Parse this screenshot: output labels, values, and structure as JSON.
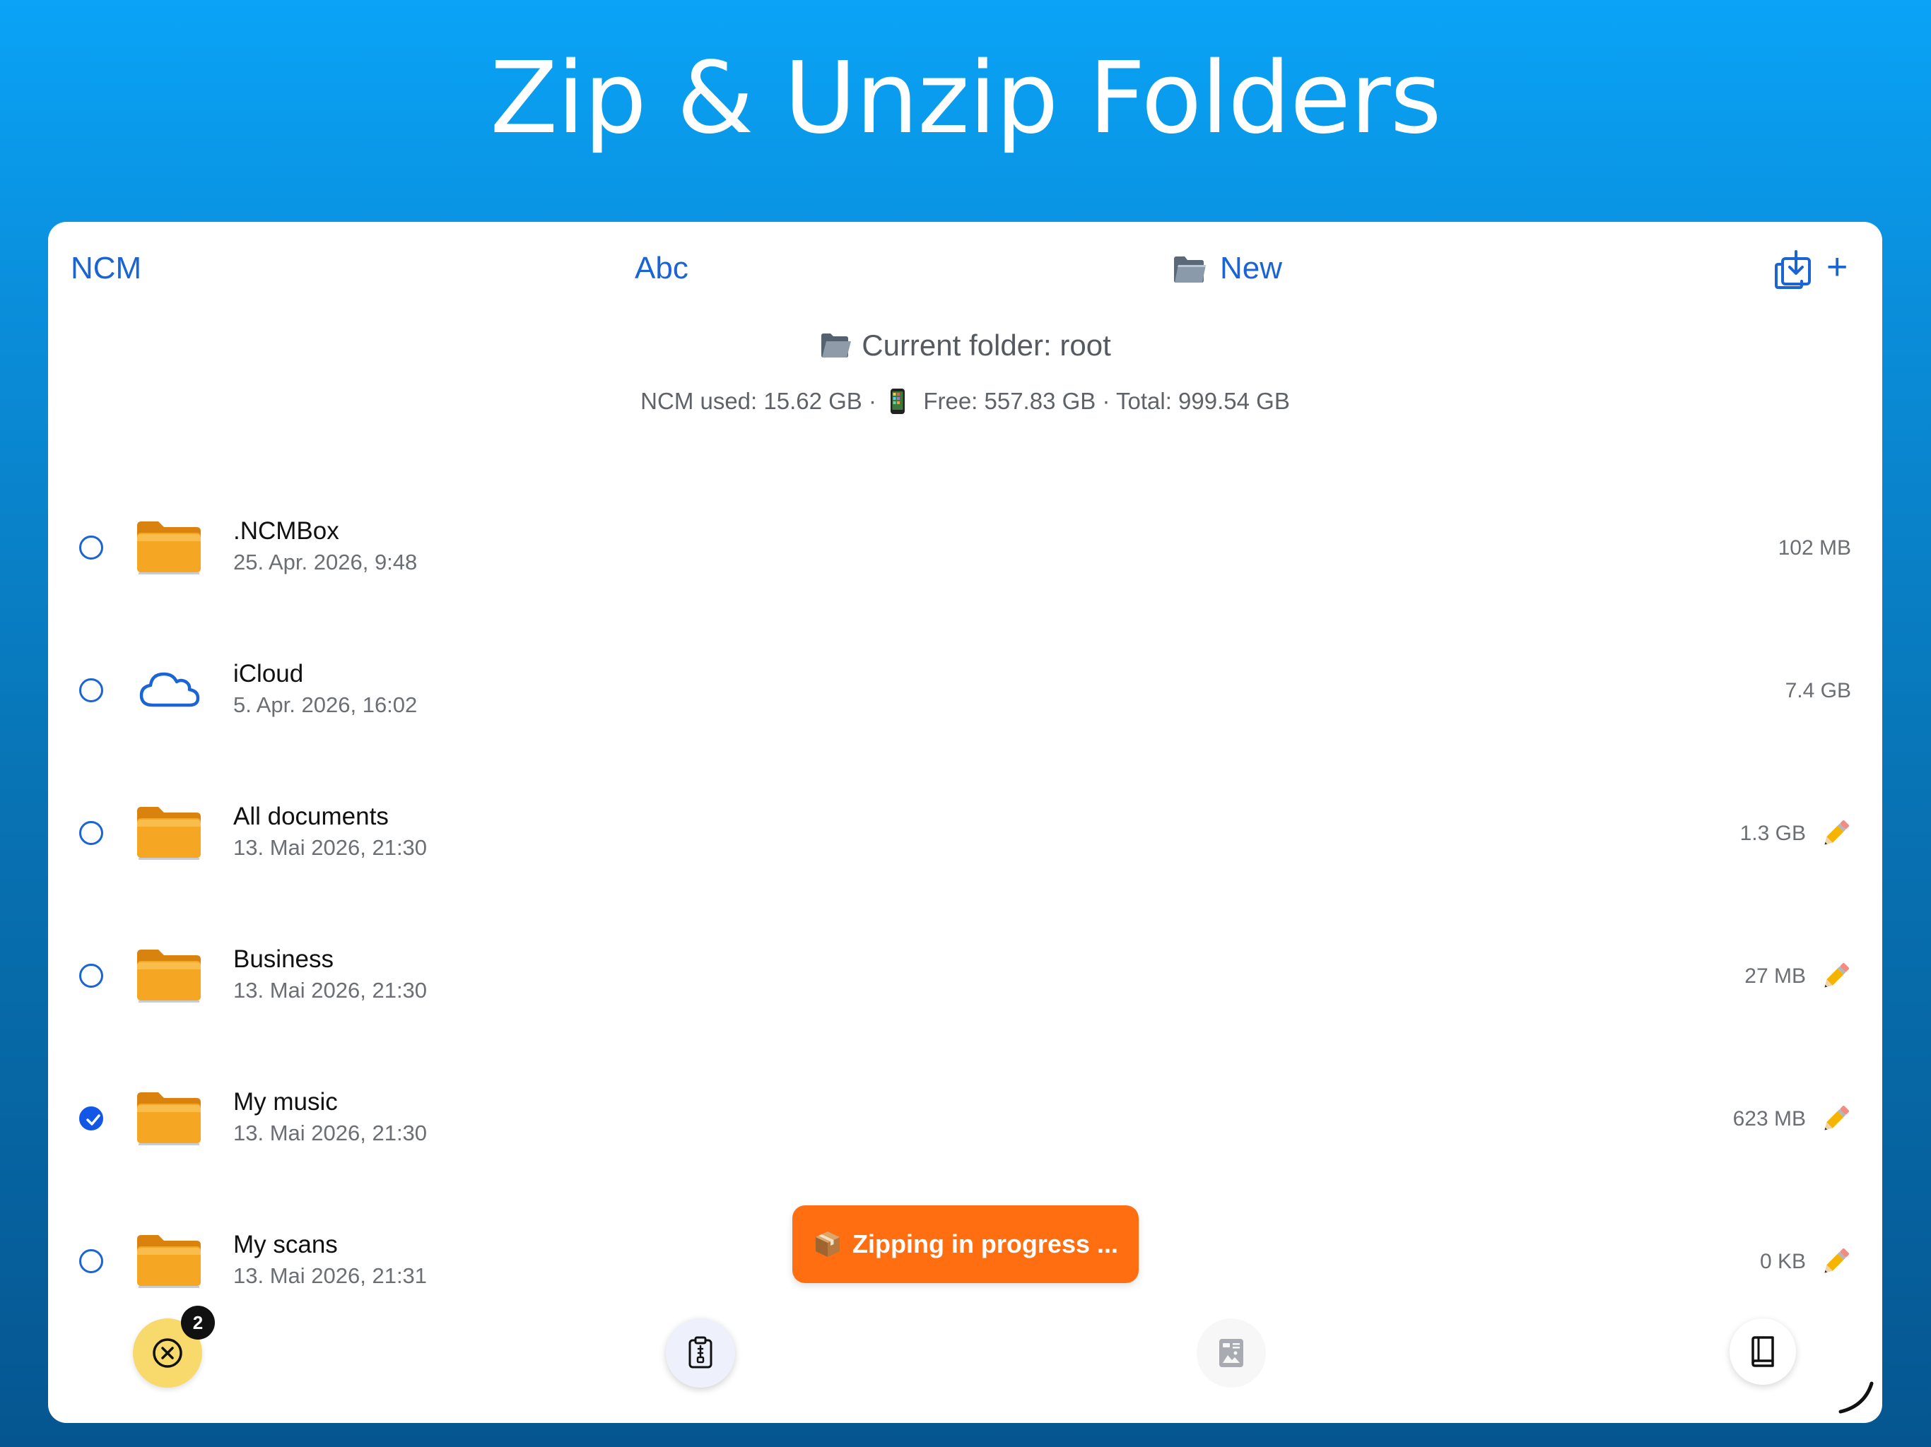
{
  "headline": "Zip & Unzip Folders",
  "toolbar": {
    "left_label": "NCM",
    "sort_label": "Abc",
    "new_label": "New",
    "import_icon": "tray-import-icon",
    "add_label": "+"
  },
  "folder": {
    "current": "Current folder: root"
  },
  "storage": {
    "used": "NCM used: 15.62 GB ·",
    "free_total": "Free: 557.83 GB · Total: 999.54 GB"
  },
  "items": [
    {
      "name": ".NCMBox",
      "date": "25. Apr. 2026, 9:48",
      "size": "102 MB",
      "selected": false,
      "icon": "folder-icon",
      "editable": false
    },
    {
      "name": "iCloud",
      "date": "5. Apr. 2026, 16:02",
      "size": "7.4 GB",
      "selected": false,
      "icon": "cloud-icon",
      "editable": false
    },
    {
      "name": "All documents",
      "date": "13. Mai 2026, 21:30",
      "size": "1.3 GB",
      "selected": false,
      "icon": "folder-icon",
      "editable": true
    },
    {
      "name": "Business",
      "date": "13. Mai 2026, 21:30",
      "size": "27 MB",
      "selected": false,
      "icon": "folder-icon",
      "editable": true
    },
    {
      "name": "My music",
      "date": "13. Mai 2026, 21:30",
      "size": "623 MB",
      "selected": true,
      "icon": "folder-icon",
      "editable": true
    },
    {
      "name": "My scans",
      "date": "13. Mai 2026, 21:31",
      "size": "0 KB",
      "selected": false,
      "icon": "folder-icon",
      "editable": true
    }
  ],
  "toast": {
    "text": "Zipping in progress ..."
  },
  "bottom": {
    "badge_count": "2"
  },
  "colors": {
    "accent": "#1a64d6",
    "toast": "#ff6f12",
    "cancel_fab": "#f8d96b"
  }
}
